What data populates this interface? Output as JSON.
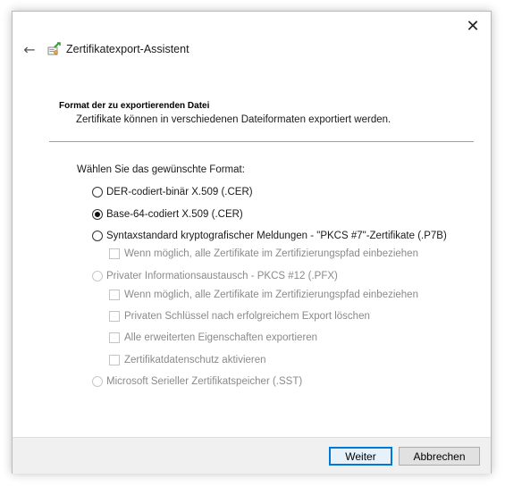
{
  "window": {
    "title": "Zertifikatexport-Assistent",
    "close_glyph": "✕",
    "back_glyph": "←",
    "icons": {
      "close": "close-icon",
      "back": "back-arrow-icon",
      "wizard": "certificate-wizard-icon"
    }
  },
  "header": {
    "section_title": "Format der zu exportierenden Datei",
    "section_subtitle": "Zertifikate können in verschiedenen Dateiformaten exportiert werden."
  },
  "main": {
    "prompt": "Wählen Sie das gewünschte Format:",
    "options": [
      {
        "label": "DER-codiert-binär X.509 (.CER)",
        "selected": false,
        "enabled": true
      },
      {
        "label": "Base-64-codiert X.509 (.CER)",
        "selected": true,
        "enabled": true
      },
      {
        "label": "Syntaxstandard kryptografischer Meldungen - \"PKCS #7\"-Zertifikate (.P7B)",
        "selected": false,
        "enabled": true
      },
      {
        "label": "Privater Informationsaustausch - PKCS #12 (.PFX)",
        "selected": false,
        "enabled": false
      },
      {
        "label": "Microsoft Serieller Zertifikatspeicher (.SST)",
        "selected": false,
        "enabled": false
      }
    ],
    "checkboxes": [
      {
        "label": "Wenn möglich, alle Zertifikate im Zertifizierungspfad einbeziehen",
        "checked": false,
        "enabled": false
      },
      {
        "label": "Wenn möglich, alle Zertifikate im Zertifizierungspfad einbeziehen",
        "checked": false,
        "enabled": false
      },
      {
        "label": "Privaten Schlüssel nach erfolgreichem Export löschen",
        "checked": false,
        "enabled": false
      },
      {
        "label": "Alle erweiterten Eigenschaften exportieren",
        "checked": false,
        "enabled": false
      },
      {
        "label": "Zertifikatdatenschutz aktivieren",
        "checked": false,
        "enabled": false
      }
    ]
  },
  "footer": {
    "next_label": "Weiter",
    "cancel_label": "Abbrechen"
  },
  "colors": {
    "accent": "#0078d7",
    "footer_bg": "#f0f0f0",
    "disabled_text": "#8a8a8a"
  }
}
